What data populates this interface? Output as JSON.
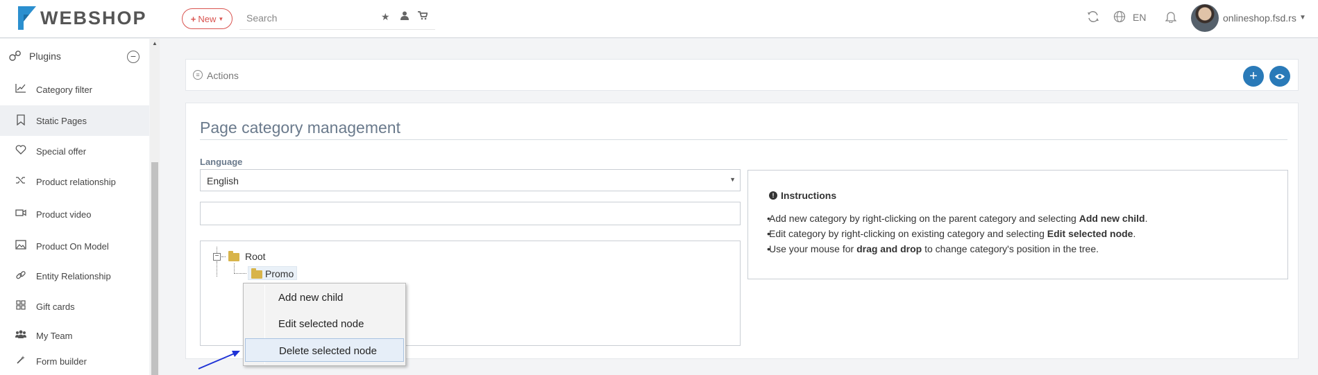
{
  "header": {
    "logo_text": "WEBSHOP",
    "new_button": "New",
    "search_placeholder": "Search",
    "language": "EN",
    "user": "onlineshop.fsd.rs",
    "icons": [
      "star-icon",
      "user-icon",
      "cart-icon",
      "refresh-icon",
      "globe-icon",
      "bell-icon"
    ]
  },
  "sidebar": {
    "section": "Plugins",
    "items": [
      {
        "label": "Category filter",
        "icon": "chart-icon"
      },
      {
        "label": "Static Pages",
        "icon": "bookmark-icon",
        "active": true
      },
      {
        "label": "Special offer",
        "icon": "heart-icon"
      },
      {
        "label": "Product relationship",
        "icon": "shuffle-icon"
      },
      {
        "label": "Product video",
        "icon": "video-icon"
      },
      {
        "label": "Product On Model",
        "icon": "image-icon"
      },
      {
        "label": "Entity Relationship",
        "icon": "link-icon"
      },
      {
        "label": "Gift cards",
        "icon": "grid-icon"
      },
      {
        "label": "My Team",
        "icon": "team-icon"
      },
      {
        "label": "Form builder",
        "icon": "wand-icon"
      }
    ]
  },
  "actions": {
    "label": "Actions"
  },
  "main": {
    "title": "Page category management",
    "language_label": "Language",
    "language_value": "English",
    "tree": {
      "root": "Root",
      "child": "Promo"
    },
    "instructions": {
      "title": "Instructions",
      "items": [
        {
          "pre": "Add new category by right-clicking on the parent category and selecting ",
          "bold": "Add new child",
          "post": "."
        },
        {
          "pre": "Edit category by right-clicking on existing category and selecting ",
          "bold": "Edit selected node",
          "post": "."
        },
        {
          "pre": "Use your mouse for ",
          "bold": "drag and drop",
          "post": " to change category's position in the tree."
        }
      ]
    }
  },
  "context_menu": {
    "items": [
      "Add new child",
      "Edit selected node",
      "Delete selected node"
    ]
  },
  "colors": {
    "accent_blue": "#2a7ab8",
    "new_red": "#d9534f",
    "annotation_arrow": "#1f33d6"
  }
}
